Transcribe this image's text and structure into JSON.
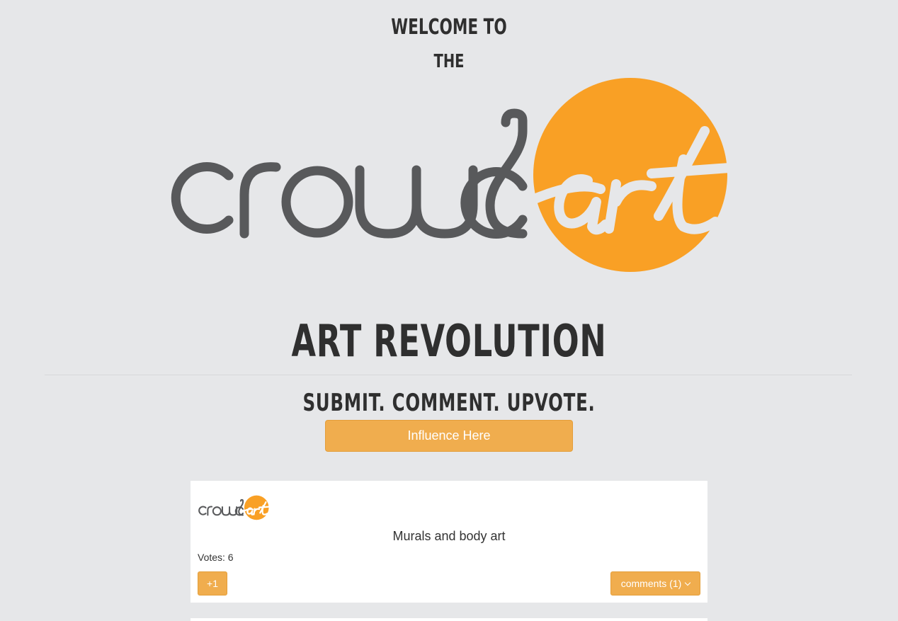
{
  "welcome": {
    "line1": "Welcome to",
    "line2": "the"
  },
  "logo": {
    "word_dark": "crowd",
    "word_orange": "art",
    "colors": {
      "dark": "#58595b",
      "orange": "#f9a025",
      "light": "#e6e7e9"
    }
  },
  "headline": "Art Revolution",
  "tagline": "Submit. Comment. Upvote.",
  "cta_button": {
    "label": "Influence Here"
  },
  "card": {
    "title": "Murals and body art",
    "votes": "Votes: 6",
    "upvote_label": "+1",
    "comments_label": "comments (1)",
    "comments_icon": "chevron-down-icon"
  },
  "colors": {
    "background": "#e6e7e9",
    "accent": "#f0ad4e",
    "text": "#333333"
  }
}
